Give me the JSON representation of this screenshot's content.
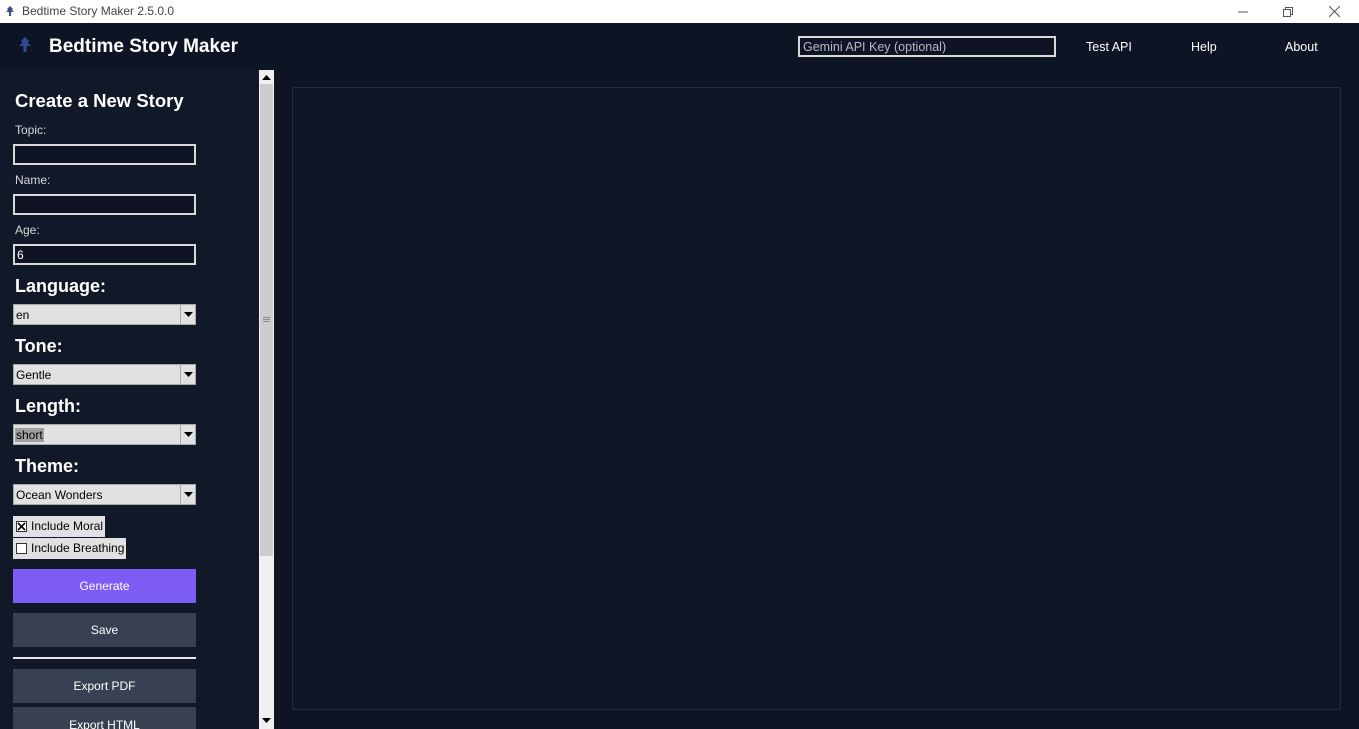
{
  "window": {
    "title": "Bedtime Story Maker 2.5.0.0"
  },
  "header": {
    "app_title": "Bedtime Story Maker",
    "api_key_placeholder": "Gemini API Key (optional)",
    "api_key_value": "",
    "links": [
      "Test API",
      "Help",
      "About"
    ]
  },
  "sidebar": {
    "heading": "Create a New Story",
    "topic": {
      "label": "Topic:",
      "value": ""
    },
    "name": {
      "label": "Name:",
      "value": ""
    },
    "age": {
      "label": "Age:",
      "value": "6"
    },
    "language": {
      "label": "Language:",
      "value": "en"
    },
    "tone": {
      "label": "Tone:",
      "value": "Gentle"
    },
    "length": {
      "label": "Length:",
      "value": "short"
    },
    "theme": {
      "label": "Theme:",
      "value": "Ocean Wonders"
    },
    "include_moral": {
      "label": "Include Moral",
      "checked": true
    },
    "include_breathing": {
      "label": "Include Breathing",
      "checked": false
    },
    "buttons": {
      "generate": "Generate",
      "save": "Save",
      "export_pdf": "Export PDF",
      "export_html": "Export HTML"
    }
  },
  "colors": {
    "background": "#0e1424",
    "sidebar": "#111827",
    "primary_button": "#7c5cf5",
    "secondary_button": "#374151"
  }
}
